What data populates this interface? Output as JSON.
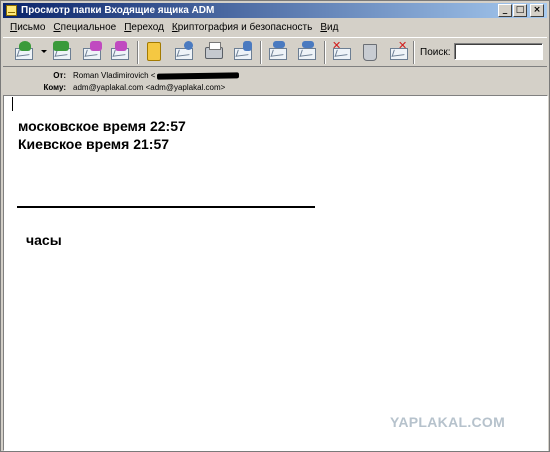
{
  "window": {
    "title": "Просмотр папки Входящие ящика ADM",
    "controls": {
      "minimize": "_",
      "maximize": "□",
      "close": "×"
    }
  },
  "menu": {
    "items": [
      "Письмо",
      "Специальное",
      "Переход",
      "Криптография и безопасность",
      "Вид"
    ]
  },
  "toolbar": {
    "buttons": [
      {
        "icon": "get-mail-icon",
        "accent": "#3a9a3a"
      },
      {
        "icon": "reply-all-icon",
        "accent": "#3a9a3a"
      },
      {
        "icon": "forward-icon",
        "accent": "#c04ac0"
      },
      {
        "icon": "redirect-icon",
        "accent": "#c04ac0"
      },
      {
        "icon": "note-icon",
        "accent": "#f5c842"
      },
      {
        "icon": "search-mail-icon",
        "accent": "#4a7ac0"
      },
      {
        "icon": "print-icon",
        "accent": "#4a7ac0"
      },
      {
        "icon": "save-mail-icon",
        "accent": "#4a7ac0"
      },
      {
        "icon": "previous-message-icon",
        "accent": "#4a7ac0"
      },
      {
        "icon": "next-message-icon",
        "accent": "#4a7ac0"
      },
      {
        "icon": "delete-mail-icon",
        "accent": "#d21b1b"
      },
      {
        "icon": "trash-icon",
        "accent": "#6b6f75"
      },
      {
        "icon": "spam-icon",
        "accent": "#d21b1b"
      }
    ],
    "search_label": "Поиск:",
    "search_value": ""
  },
  "header": {
    "from_label": "От:",
    "from_value": "Roman Vladimirovich <",
    "to_label": "Кому:",
    "to_value": "adm@yaplakal.com <adm@yaplakal.com>"
  },
  "message": {
    "line1": "московское время 22:57",
    "line2": "Киевское время 21:57",
    "line3": "часы"
  },
  "watermark": "YAPLAKAL.COM"
}
